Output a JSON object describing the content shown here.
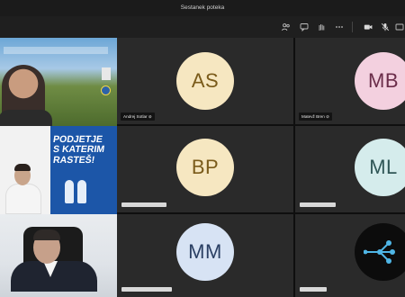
{
  "window": {
    "title": "Sestanek poteka"
  },
  "toolbar": {
    "buttons": [
      {
        "name": "people-icon"
      },
      {
        "name": "chat-icon"
      },
      {
        "name": "raise-hand-icon"
      },
      {
        "name": "more-icon"
      },
      {
        "name": "camera-icon"
      },
      {
        "name": "mic-off-icon"
      },
      {
        "name": "share-icon"
      }
    ]
  },
  "video_tiles": [
    {
      "id": "v1"
    },
    {
      "id": "v2",
      "poster": {
        "line1": "PODJETJE",
        "line2": "S KATERIM",
        "line3": "RASTEŠ!"
      }
    },
    {
      "id": "v3"
    }
  ],
  "avatar_tiles": [
    {
      "initials": "AS",
      "name": "Andrej Sotlar",
      "bg": "#f6e7c1",
      "fg": "#7a5b1a"
    },
    {
      "initials": "MB",
      "name": "Matevž Bren",
      "bg": "#f3d0df",
      "fg": "#6b2d4a"
    },
    {
      "initials": "BP",
      "name": "",
      "bg": "#f6e7c1",
      "fg": "#7a5b1a"
    },
    {
      "initials": "ML",
      "name": "",
      "bg": "#d5ecec",
      "fg": "#2f5656"
    },
    {
      "initials": "MM",
      "name": "",
      "bg": "#d7e3f4",
      "fg": "#2a3f63"
    }
  ],
  "colors": {
    "accent_leave": "#c4314b",
    "tile_bg": "#2a2a2a"
  }
}
